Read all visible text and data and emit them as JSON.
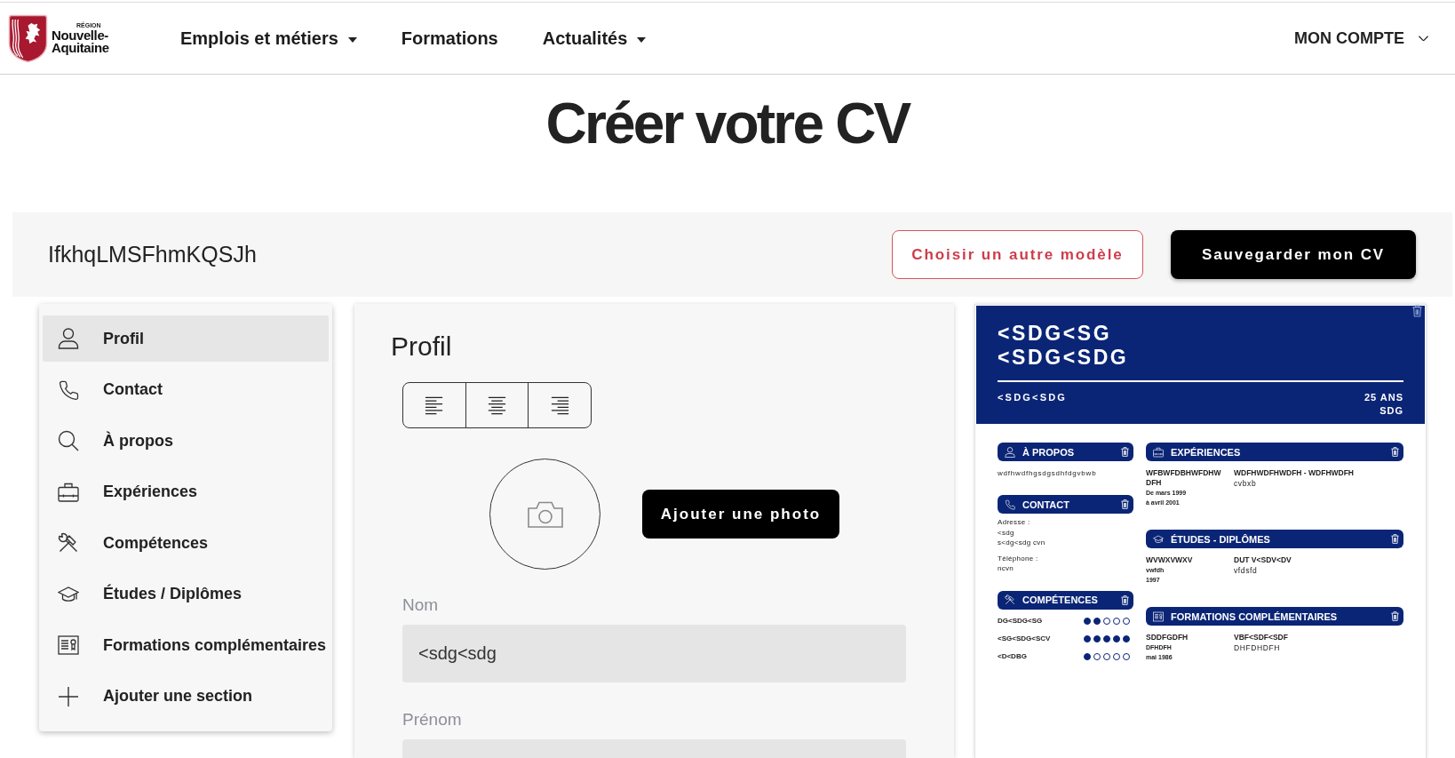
{
  "header": {
    "logo": {
      "region": "RÉGION",
      "name_lines": [
        "Nouvelle-",
        "Aquitaine"
      ]
    },
    "nav": [
      {
        "label": "Emplois et métiers",
        "dropdown": true
      },
      {
        "label": "Formations",
        "dropdown": false
      },
      {
        "label": "Actualités",
        "dropdown": true
      }
    ],
    "account": "MON COMPTE"
  },
  "page_title": "Créer votre CV",
  "toolbar": {
    "cv_name": "IfkhqLMSFhmKQSJh",
    "buttons": [
      {
        "label": "Choisir un autre modèle",
        "kind": "outline"
      },
      {
        "label": "Sauvegarder mon CV",
        "kind": "primary"
      }
    ]
  },
  "sidebar": {
    "items": [
      {
        "label": "Profil",
        "kind": "profile",
        "selected": true
      },
      {
        "label": "Contact",
        "kind": "contact",
        "selected": false
      },
      {
        "label": "À propos",
        "kind": "about",
        "selected": false
      },
      {
        "label": "Expériences",
        "kind": "experience",
        "selected": false
      },
      {
        "label": "Compétences",
        "kind": "skills",
        "selected": false
      },
      {
        "label": "Études / Diplômes",
        "kind": "education",
        "selected": false
      },
      {
        "label": "Formations complémentaires",
        "kind": "training",
        "selected": false
      },
      {
        "label": "Ajouter une section",
        "kind": "add",
        "selected": false
      }
    ]
  },
  "editor": {
    "title": "Profil",
    "alignment": [
      {
        "kind": "left"
      },
      {
        "kind": "center"
      },
      {
        "kind": "right"
      }
    ],
    "photo_button": "Ajouter une photo",
    "fields": [
      {
        "label": "Nom",
        "value": "<sdg<sdg"
      },
      {
        "label": "Prénom"
      }
    ]
  },
  "preview": {
    "name_lines": [
      "<SDG<SG",
      "<SDG<SDG"
    ],
    "subtitle": "<SDG<SDG",
    "details": [
      "25 ANS",
      "SDG"
    ],
    "left_sections": [
      {
        "kind": "about",
        "title": "À PROPOS",
        "text": "wdfhwdfhgsdgsdhfdgvbwb"
      },
      {
        "kind": "contact",
        "title": "CONTACT",
        "groups": [
          {
            "label": "Adresse :",
            "lines": [
              "<sdg",
              "s<dg<sdg cvn"
            ]
          },
          {
            "label": "Téléphone :",
            "lines": [
              "ncvn"
            ]
          }
        ]
      },
      {
        "kind": "skills",
        "title": "COMPÉTENCES",
        "skills": [
          {
            "name": "DG<SDG<SG",
            "stars": 2
          },
          {
            "name": "<SG<SDG<SCV",
            "stars": 5
          },
          {
            "name": "<D<DBG",
            "stars": 1
          }
        ]
      }
    ],
    "right_sections": [
      {
        "kind": "experience",
        "title": "EXPÉRIENCES",
        "entries": [
          {
            "heading": "WFBWFDBHWFDHW DFH",
            "sub_lines": [
              "De mars 1999",
              "à avril 2001"
            ],
            "title": "WDFHWDFHWDFH - WDFHWDFH",
            "detail": "cvbxb"
          }
        ]
      },
      {
        "kind": "education",
        "title": "ÉTUDES - DIPLÔMES",
        "entries": [
          {
            "heading": "WVWXVWXV",
            "sub_lines": [
              "vwfdh",
              "1997"
            ],
            "title": "DUT V<SDV<DV",
            "detail": "vfdsfd"
          }
        ]
      },
      {
        "kind": "training",
        "title": "FORMATIONS COMPLÉMENTAIRES",
        "entries": [
          {
            "heading": "SDDFGDFH",
            "sub_lines": [
              "DFHDFH",
              "mai 1986"
            ],
            "title": "VBF<SDF<SDF",
            "detail": "DHFDHDFH"
          }
        ]
      }
    ]
  }
}
